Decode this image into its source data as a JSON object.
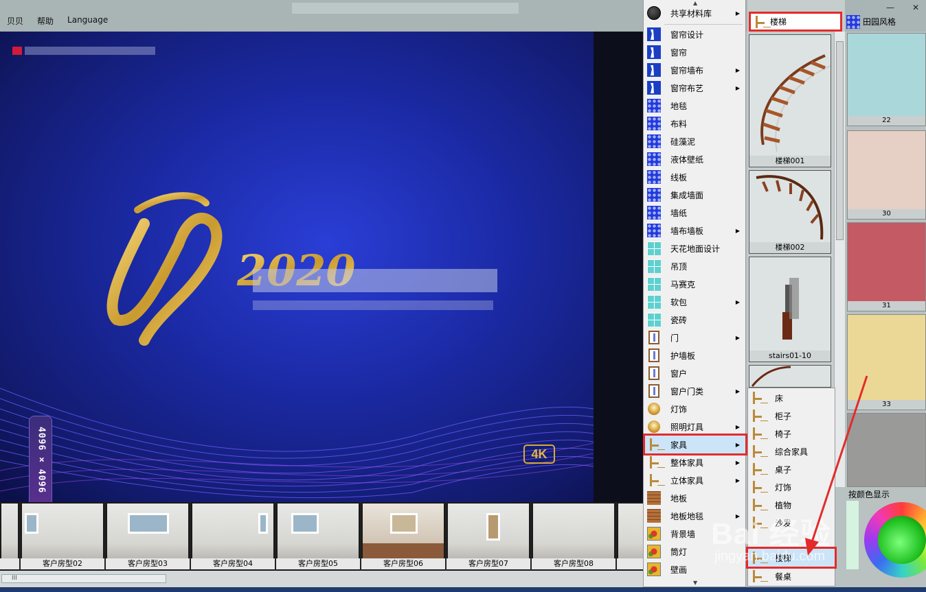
{
  "menubar": {
    "items": [
      "贝贝",
      "帮助",
      "Language"
    ]
  },
  "window_controls": {
    "minimize": "—",
    "close": "✕"
  },
  "stage": {
    "logo_text": "2020",
    "badge_4k": "4K",
    "resolution": "4096 × 4096"
  },
  "thumbnails": [
    "",
    "客户房型02",
    "客户房型03",
    "客户房型04",
    "客户房型05",
    "客户房型06",
    "客户房型07",
    "客户房型08",
    "客户"
  ],
  "hscroll_label": "III",
  "menu_main": {
    "items": [
      {
        "label": "共享材料库",
        "icon": "globe-icon",
        "submenu": true
      },
      {
        "label": "窗帘设计",
        "icon": "curtain-icon",
        "submenu": false
      },
      {
        "label": "窗帘",
        "icon": "curtain-icon",
        "submenu": false
      },
      {
        "label": "窗帘墙布",
        "icon": "curtain-icon",
        "submenu": true
      },
      {
        "label": "窗帘布艺",
        "icon": "curtain-icon",
        "submenu": true
      },
      {
        "label": "地毯",
        "icon": "pattern-icon",
        "submenu": false
      },
      {
        "label": "布料",
        "icon": "pattern-icon",
        "submenu": false
      },
      {
        "label": "硅藻泥",
        "icon": "pattern-icon",
        "submenu": false
      },
      {
        "label": "液体壁纸",
        "icon": "pattern-icon",
        "submenu": false
      },
      {
        "label": "线板",
        "icon": "pattern-icon",
        "submenu": false
      },
      {
        "label": "集成墙面",
        "icon": "pattern-icon",
        "submenu": false
      },
      {
        "label": "墙纸",
        "icon": "pattern-icon",
        "submenu": false
      },
      {
        "label": "墙布墙板",
        "icon": "pattern-icon",
        "submenu": true
      },
      {
        "label": "天花地面设计",
        "icon": "grid-icon",
        "submenu": false
      },
      {
        "label": "吊顶",
        "icon": "grid-icon",
        "submenu": false
      },
      {
        "label": "马赛克",
        "icon": "grid-icon",
        "submenu": false
      },
      {
        "label": "软包",
        "icon": "grid-icon",
        "submenu": true
      },
      {
        "label": "瓷砖",
        "icon": "grid-icon",
        "submenu": false
      },
      {
        "label": "门",
        "icon": "door-icon",
        "submenu": true
      },
      {
        "label": "护墙板",
        "icon": "door-icon",
        "submenu": false
      },
      {
        "label": "窗户",
        "icon": "door-icon",
        "submenu": false
      },
      {
        "label": "窗户门类",
        "icon": "door-icon",
        "submenu": true
      },
      {
        "label": "灯饰",
        "icon": "lamp-icon",
        "submenu": false
      },
      {
        "label": "照明灯具",
        "icon": "lamp-icon",
        "submenu": true
      },
      {
        "label": "家具",
        "icon": "chair-icon",
        "submenu": true
      },
      {
        "label": "整体家具",
        "icon": "chair-icon",
        "submenu": true
      },
      {
        "label": "立体家具",
        "icon": "chair-icon",
        "submenu": true
      },
      {
        "label": "地板",
        "icon": "wood-icon",
        "submenu": false
      },
      {
        "label": "地板地毯",
        "icon": "wood-icon",
        "submenu": true
      },
      {
        "label": "背景墙",
        "icon": "flower-icon",
        "submenu": false
      },
      {
        "label": "筒灯",
        "icon": "flower-icon",
        "submenu": false
      },
      {
        "label": "壁画",
        "icon": "flower-icon",
        "submenu": false
      }
    ]
  },
  "menu_furniture": {
    "items": [
      "床",
      "柜子",
      "椅子",
      "综合家具",
      "桌子",
      "灯饰",
      "植物",
      "沙发",
      "楼梯",
      "餐桌"
    ]
  },
  "stairs_panel": {
    "header": "楼梯",
    "items": [
      "楼梯001",
      "楼梯002",
      "stairs01-10",
      ""
    ]
  },
  "color_panel": {
    "header": "田园风格",
    "swatches": [
      {
        "label": "22",
        "color": "#a9d7da"
      },
      {
        "label": "30",
        "color": "#e6cfc4"
      },
      {
        "label": "31",
        "color": "#c45a64"
      },
      {
        "label": "33",
        "color": "#ecd896"
      },
      {
        "label": "",
        "color": "#9a9a98"
      }
    ],
    "by_color_label": "按颜色显示"
  },
  "watermark": {
    "brand": "Bai 经验",
    "url": "jingyan.baidu.com"
  }
}
